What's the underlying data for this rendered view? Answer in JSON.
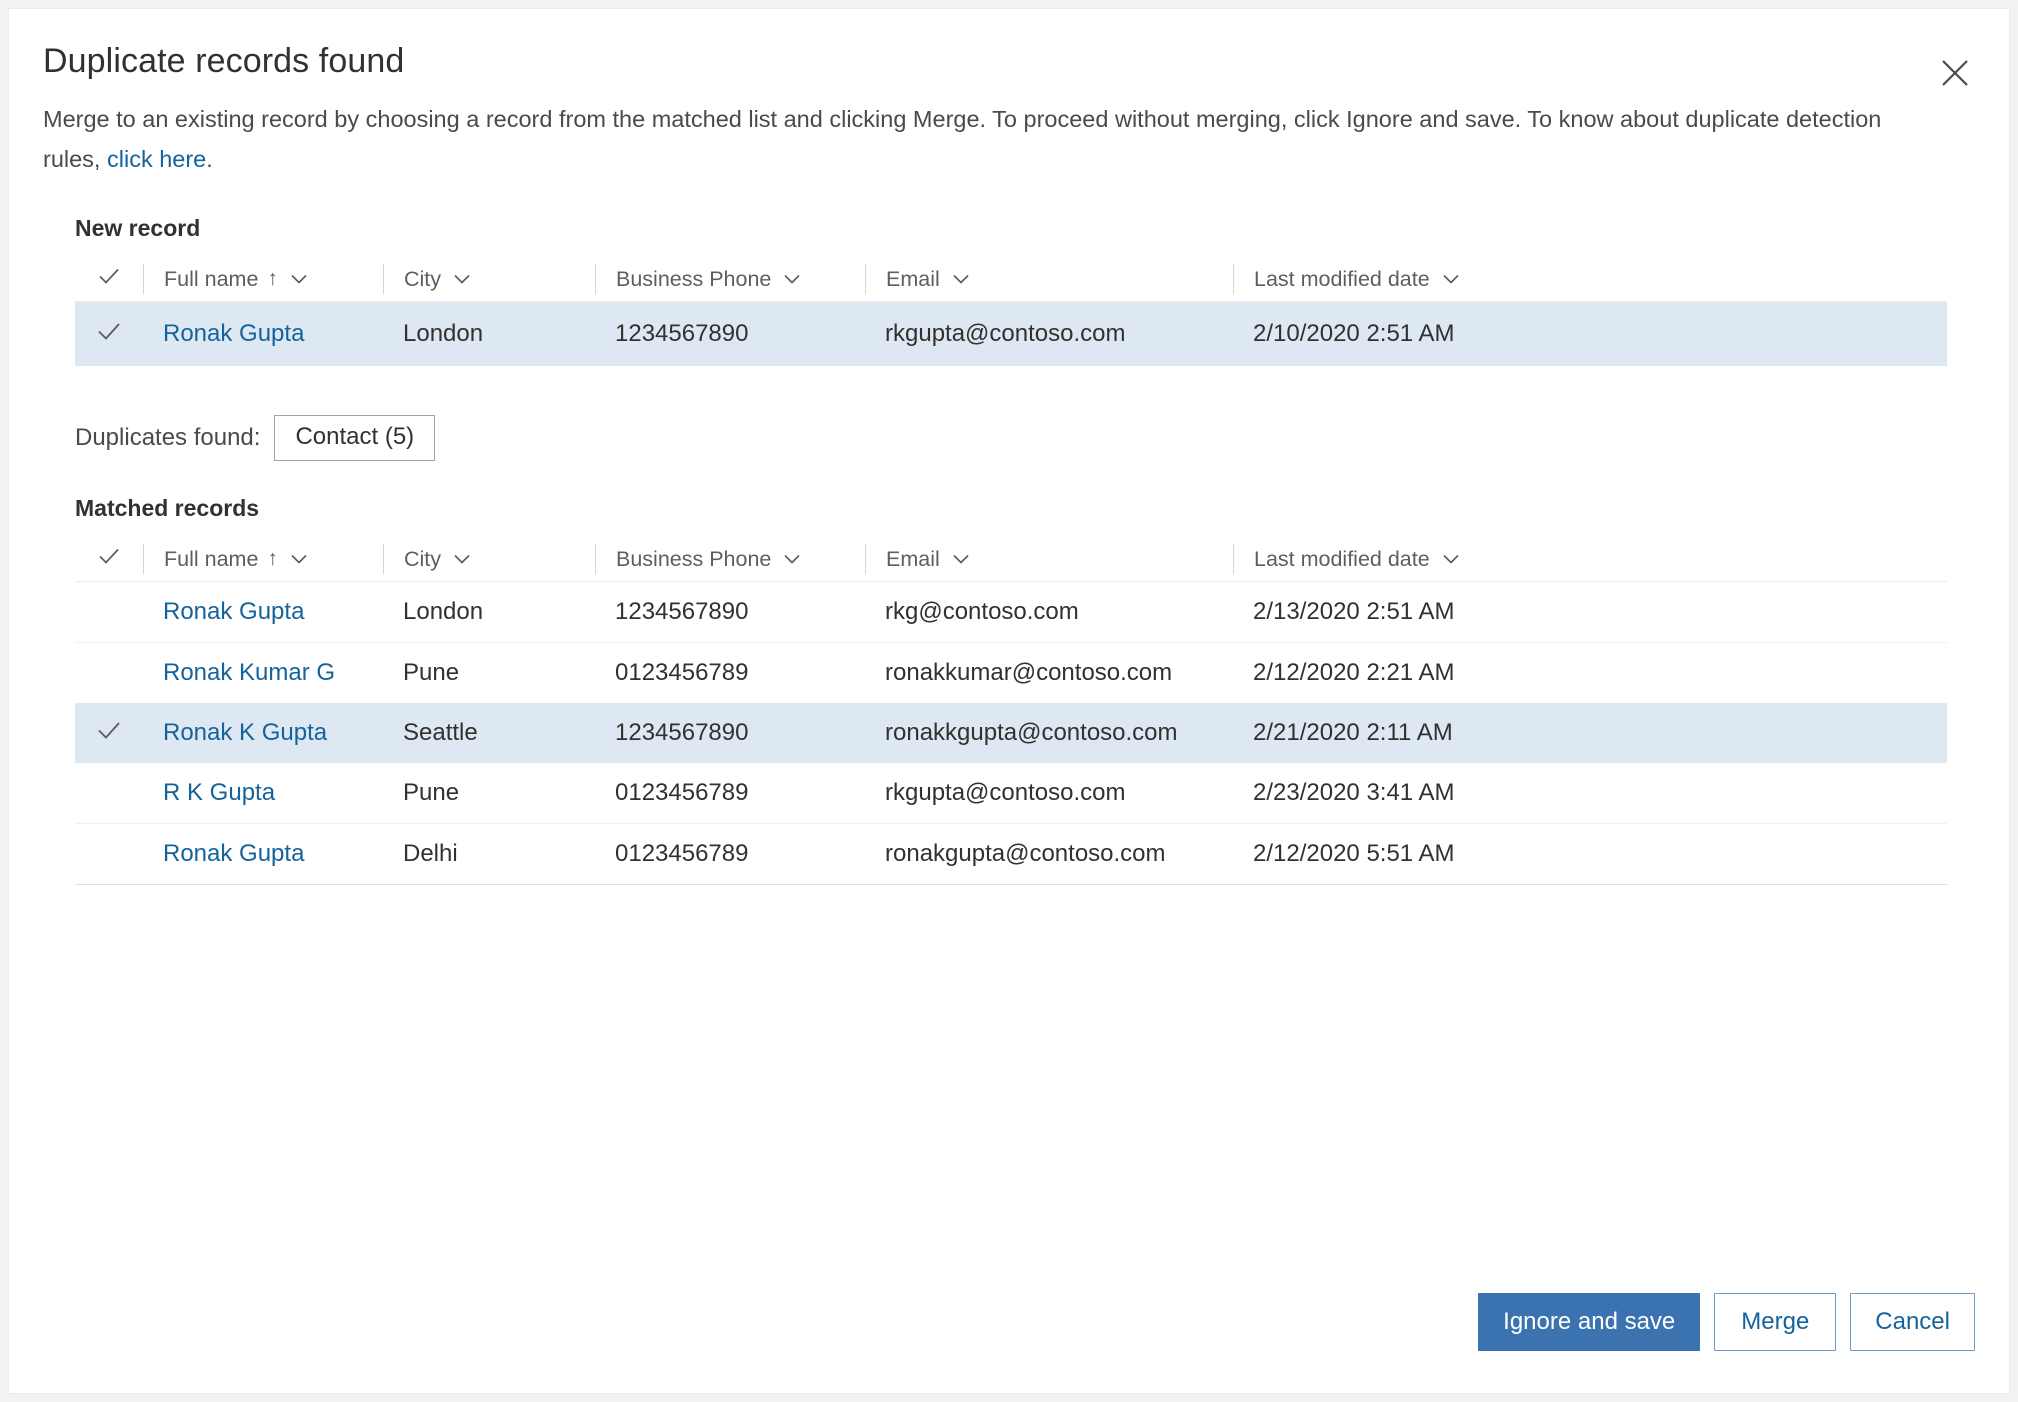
{
  "dialog": {
    "title": "Duplicate records found",
    "close_icon": "close-icon",
    "description_part1": "Merge to an existing record by choosing a record from the matched list and clicking Merge. To proceed without merging, click Ignore and save. To know about duplicate detection rules, ",
    "description_link": "click here",
    "description_part2": "."
  },
  "new_record": {
    "label": "New record",
    "columns": [
      {
        "label": "",
        "icon": "check-icon"
      },
      {
        "label": "Full name",
        "sort": "↑",
        "icon": "chevron-down-icon"
      },
      {
        "label": "City",
        "icon": "chevron-down-icon"
      },
      {
        "label": "Business Phone",
        "icon": "chevron-down-icon"
      },
      {
        "label": "Email",
        "icon": "chevron-down-icon"
      },
      {
        "label": "Last modified date",
        "icon": "chevron-down-icon"
      }
    ],
    "rows": [
      {
        "selected": true,
        "full_name": "Ronak Gupta",
        "city": "London",
        "business_phone": "1234567890",
        "email": "rkgupta@contoso.com",
        "last_modified_date": "2/10/2020 2:51 AM"
      }
    ]
  },
  "duplicates_found": {
    "label": "Duplicates found:",
    "entity_button": "Contact (5)"
  },
  "matched_records": {
    "label": "Matched records",
    "columns": [
      {
        "label": "",
        "icon": "check-icon"
      },
      {
        "label": "Full name",
        "sort": "↑",
        "icon": "chevron-down-icon"
      },
      {
        "label": "City",
        "icon": "chevron-down-icon"
      },
      {
        "label": "Business Phone",
        "icon": "chevron-down-icon"
      },
      {
        "label": "Email",
        "icon": "chevron-down-icon"
      },
      {
        "label": "Last modified date",
        "icon": "chevron-down-icon"
      }
    ],
    "rows": [
      {
        "selected": false,
        "full_name": "Ronak Gupta",
        "city": "London",
        "business_phone": "1234567890",
        "email": "rkg@contoso.com",
        "last_modified_date": "2/13/2020 2:51 AM"
      },
      {
        "selected": false,
        "full_name": "Ronak Kumar G",
        "city": "Pune",
        "business_phone": "0123456789",
        "email": "ronakkumar@contoso.com",
        "last_modified_date": "2/12/2020 2:21 AM"
      },
      {
        "selected": true,
        "full_name": "Ronak K Gupta",
        "city": "Seattle",
        "business_phone": "1234567890",
        "email": "ronakkgupta@contoso.com",
        "last_modified_date": "2/21/2020 2:11 AM"
      },
      {
        "selected": false,
        "full_name": "R K Gupta",
        "city": "Pune",
        "business_phone": "0123456789",
        "email": "rkgupta@contoso.com",
        "last_modified_date": "2/23/2020 3:41 AM"
      },
      {
        "selected": false,
        "full_name": "Ronak Gupta",
        "city": "Delhi",
        "business_phone": "0123456789",
        "email": "ronakgupta@contoso.com",
        "last_modified_date": "2/12/2020 5:51 AM"
      }
    ]
  },
  "footer": {
    "ignore_and_save": "Ignore and save",
    "merge": "Merge",
    "cancel": "Cancel"
  },
  "colors": {
    "primary_blue": "#3b73b0",
    "link_blue": "#15639c",
    "selected_row": "#dee8f2",
    "text": "#323130",
    "muted_text": "#605e5c",
    "dialog_bg": "#ffffff",
    "page_bg": "#f3f2f1"
  }
}
